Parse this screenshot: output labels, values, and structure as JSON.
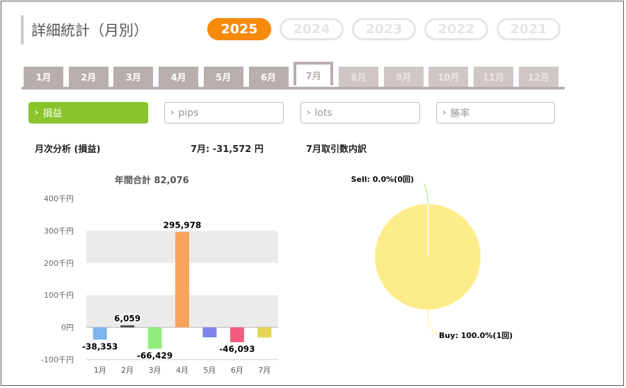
{
  "header": {
    "title": "詳細統計（月別）"
  },
  "years": [
    {
      "label": "2025",
      "active": true
    },
    {
      "label": "2024",
      "active": false
    },
    {
      "label": "2023",
      "active": false
    },
    {
      "label": "2022",
      "active": false
    },
    {
      "label": "2021",
      "active": false
    }
  ],
  "months": [
    {
      "label": "1月",
      "state": "normal"
    },
    {
      "label": "2月",
      "state": "normal"
    },
    {
      "label": "3月",
      "state": "normal"
    },
    {
      "label": "4月",
      "state": "normal"
    },
    {
      "label": "5月",
      "state": "normal"
    },
    {
      "label": "6月",
      "state": "normal"
    },
    {
      "label": "7月",
      "state": "active"
    },
    {
      "label": "8月",
      "state": "disabled"
    },
    {
      "label": "9月",
      "state": "disabled"
    },
    {
      "label": "10月",
      "state": "disabled"
    },
    {
      "label": "11月",
      "state": "disabled"
    },
    {
      "label": "12月",
      "state": "disabled"
    }
  ],
  "metrics": [
    {
      "label": "損益",
      "active": true
    },
    {
      "label": "pips",
      "active": false
    },
    {
      "label": "lots",
      "active": false
    },
    {
      "label": "勝率",
      "active": false
    }
  ],
  "analysis": {
    "heading": "月次分析 (損益)",
    "month_result": "7月:  -31,572 円",
    "breakdown_heading": "7月取引数内訳",
    "annual_total": "年間合計 82,076"
  },
  "colors": {
    "accent_orange": "#f58a0b",
    "accent_green": "#8ac42c",
    "tab_gray": "#b8aeac"
  },
  "chart_data": [
    {
      "type": "bar",
      "categories": [
        "1月",
        "2月",
        "3月",
        "4月",
        "5月",
        "6月",
        "7月"
      ],
      "values": [
        -38353,
        6059,
        -66429,
        295978,
        -31000,
        -46093,
        -31572
      ],
      "data_labels": [
        "-38,353",
        "6,059",
        "-66,429",
        "295,978",
        "",
        "-46,093",
        ""
      ],
      "bar_colors": [
        "#7cb5ec",
        "#434348",
        "#90ed7d",
        "#f7a35c",
        "#8085e9",
        "#f15c80",
        "#e4d354"
      ],
      "yticks": [
        -100000,
        0,
        100000,
        200000,
        300000,
        400000
      ],
      "ytick_labels": [
        "-100千円",
        "0円",
        "100千円",
        "200千円",
        "300千円",
        "400千円"
      ],
      "ylim": [
        -100000,
        400000
      ],
      "title": "年間合計 82,076"
    },
    {
      "type": "pie",
      "categories": [
        "Sell",
        "Buy"
      ],
      "values": [
        0,
        100
      ],
      "labels": [
        "Sell: 0.0%(0回)",
        "Buy: 100.0%(1回)"
      ],
      "colors": [
        "#90ed7d",
        "#fdec8a"
      ]
    }
  ]
}
